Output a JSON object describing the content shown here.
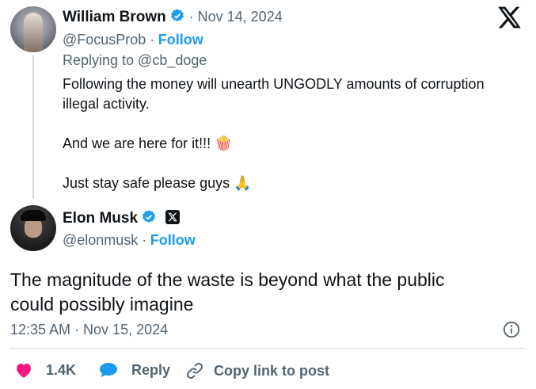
{
  "parent_tweet": {
    "author_name": "William Brown",
    "date": "· Nov 14, 2024",
    "handle": "@FocusProb ·",
    "follow_label": "Follow",
    "replying_to": "Replying to @cb_doge",
    "paragraphs": [
      "Following the money will unearth UNGODLY amounts of corruption",
      "illegal activity.",
      "And we are here for it!!! 🍿",
      "Just stay safe please guys 🙏"
    ]
  },
  "main_tweet": {
    "author_name": "Elon Musk",
    "handle": "@elonmusk ·",
    "follow_label": "Follow",
    "text_lines": [
      "The magnitude of the waste is beyond what the public",
      "could possibly imagine"
    ],
    "timestamp": "12:35 AM · Nov 15, 2024"
  },
  "actions": {
    "likes": "1.4K",
    "reply_label": "Reply",
    "copy_label": "Copy link to post"
  },
  "icons": {
    "brand": "x-logo-icon",
    "verified": "verified-badge-icon",
    "info": "info-icon",
    "like": "heart-icon",
    "reply": "reply-bubble-icon",
    "link": "link-icon"
  },
  "colors": {
    "accent": "#1d9bf0",
    "like": "#f91880",
    "text": "#0f1419",
    "muted": "#536471"
  }
}
